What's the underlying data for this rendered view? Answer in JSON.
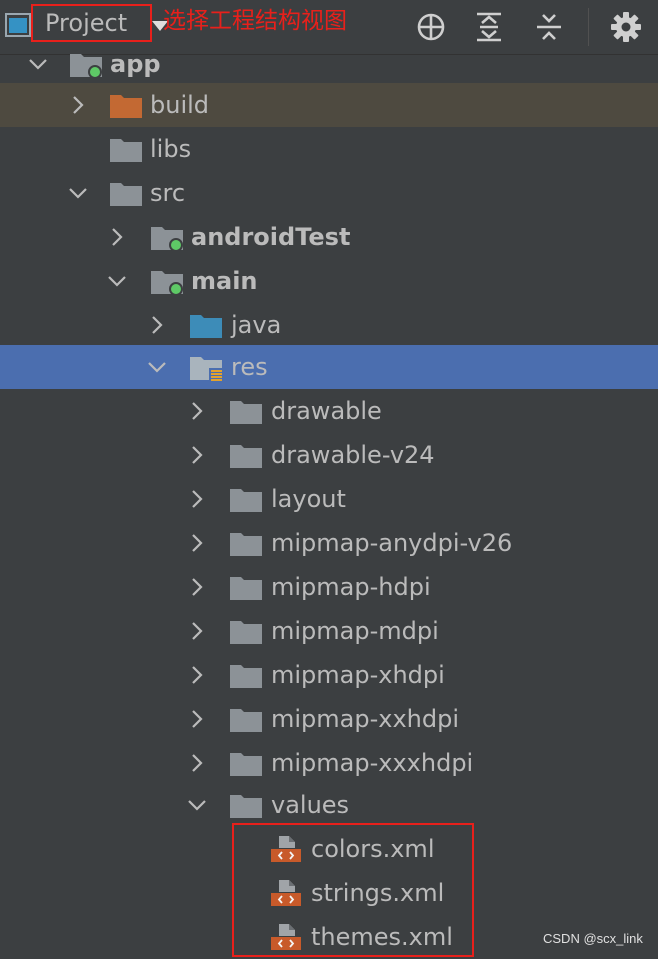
{
  "toolbar": {
    "view_label": "Project",
    "annotation": "选择工程结构视图",
    "buttons": [
      "locate-icon",
      "expand-all-icon",
      "collapse-all-icon",
      "gear-icon"
    ]
  },
  "tree": {
    "app": "app",
    "build": "build",
    "libs": "libs",
    "src": "src",
    "androidTest": "androidTest",
    "main": "main",
    "java": "java",
    "res": "res",
    "drawable": "drawable",
    "drawable_v24": "drawable-v24",
    "layout": "layout",
    "mipmap_anydpi_v26": "mipmap-anydpi-v26",
    "mipmap_hdpi": "mipmap-hdpi",
    "mipmap_mdpi": "mipmap-mdpi",
    "mipmap_xhdpi": "mipmap-xhdpi",
    "mipmap_xxhdpi": "mipmap-xxhdpi",
    "mipmap_xxxhdpi": "mipmap-xxxhdpi",
    "values": "values",
    "colors": "colors.xml",
    "strings": "strings.xml",
    "themes": "themes.xml"
  },
  "watermark": "CSDN @scx_link",
  "colors": {
    "background": "#3c3f41",
    "selection": "#4b6eaf",
    "highlight": "#4e4a40",
    "annotation": "#e8201b",
    "folder": "#8c9297",
    "excluded_folder": "#c36933",
    "source_folder": "#3d8cb8",
    "module_dot": "#5ec966"
  }
}
